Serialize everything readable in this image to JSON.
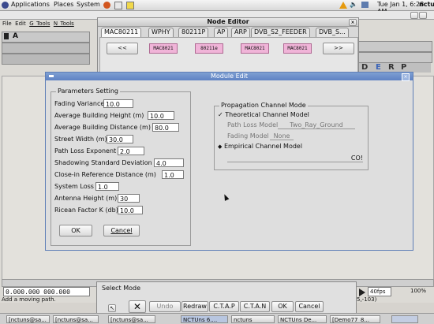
{
  "topbar": {
    "menus": [
      "Applications",
      "Places",
      "System"
    ],
    "clock": "Tue Jan 1,  6:28 AM",
    "user": "nctu"
  },
  "main_window": {
    "menu": [
      "File",
      "Edit",
      "G_Tools",
      "N_Tools"
    ],
    "status": "Add a moving path.",
    "coords": "0.000.000  000.000",
    "coord_right": "5,-103)",
    "speed": "40fps",
    "zoom": "100%"
  },
  "node_editor": {
    "title": "Node Editor",
    "tabs": [
      "MAC80211",
      "WPHY",
      "80211P",
      "AP",
      "ARP",
      "DVB_S2_FEEDER",
      "DVB_S..."
    ],
    "nav_prev": "<<",
    "nav_next": ">>",
    "modules": [
      "MAC8021",
      "80211e",
      "MAC8021",
      "MAC8021"
    ]
  },
  "module_edit": {
    "title": "Module Edit",
    "params_legend": "Parameters Setting",
    "params": [
      {
        "label": "Fading Variance",
        "value": "10.0"
      },
      {
        "label": "Average Building Height (m)",
        "value": "10.0"
      },
      {
        "label": "Average Building Distance (m)",
        "value": "80.0"
      },
      {
        "label": "Street Width (m)",
        "value": "30.0"
      },
      {
        "label": "Path Loss Exponent",
        "value": "2.0"
      },
      {
        "label": "Shadowing Standard Deviation",
        "value": "4.0"
      },
      {
        "label": "Close-in Reference Distance (m)",
        "value": "1.0"
      },
      {
        "label": "System Loss",
        "value": "1.0"
      },
      {
        "label": "Antenna Height (m)",
        "value": "30"
      },
      {
        "label": "Ricean Factor K (db)",
        "value": "10.0"
      }
    ],
    "prop_legend": "Propagation Channel Mode",
    "theoretical": "Theoretical Channel Model",
    "path_loss_label": "Path Loss Model",
    "path_loss_value": "Two_Ray_Ground",
    "fading_label": "Fading Model",
    "fading_value": "None",
    "empirical": "Empirical Channel Model",
    "empirical_value": "CO!",
    "ok": "OK",
    "cancel": "Cancel"
  },
  "select_mode": {
    "title": "Select Mode",
    "buttons": [
      "Undo",
      "Redraw",
      "C.T.A.P",
      "C.T.A.N",
      "OK",
      "Cancel"
    ]
  },
  "taskbar": {
    "items": [
      "[nctuns@sa...",
      "[nctuns@sa...",
      "[nctuns@sa...",
      "NCTUns 6....",
      "nctuns",
      "NCTUns De...",
      "[Demo77_8..."
    ]
  },
  "colors": {
    "title_blue": "#6f92cc",
    "module_pink": "#f0b4d8"
  }
}
